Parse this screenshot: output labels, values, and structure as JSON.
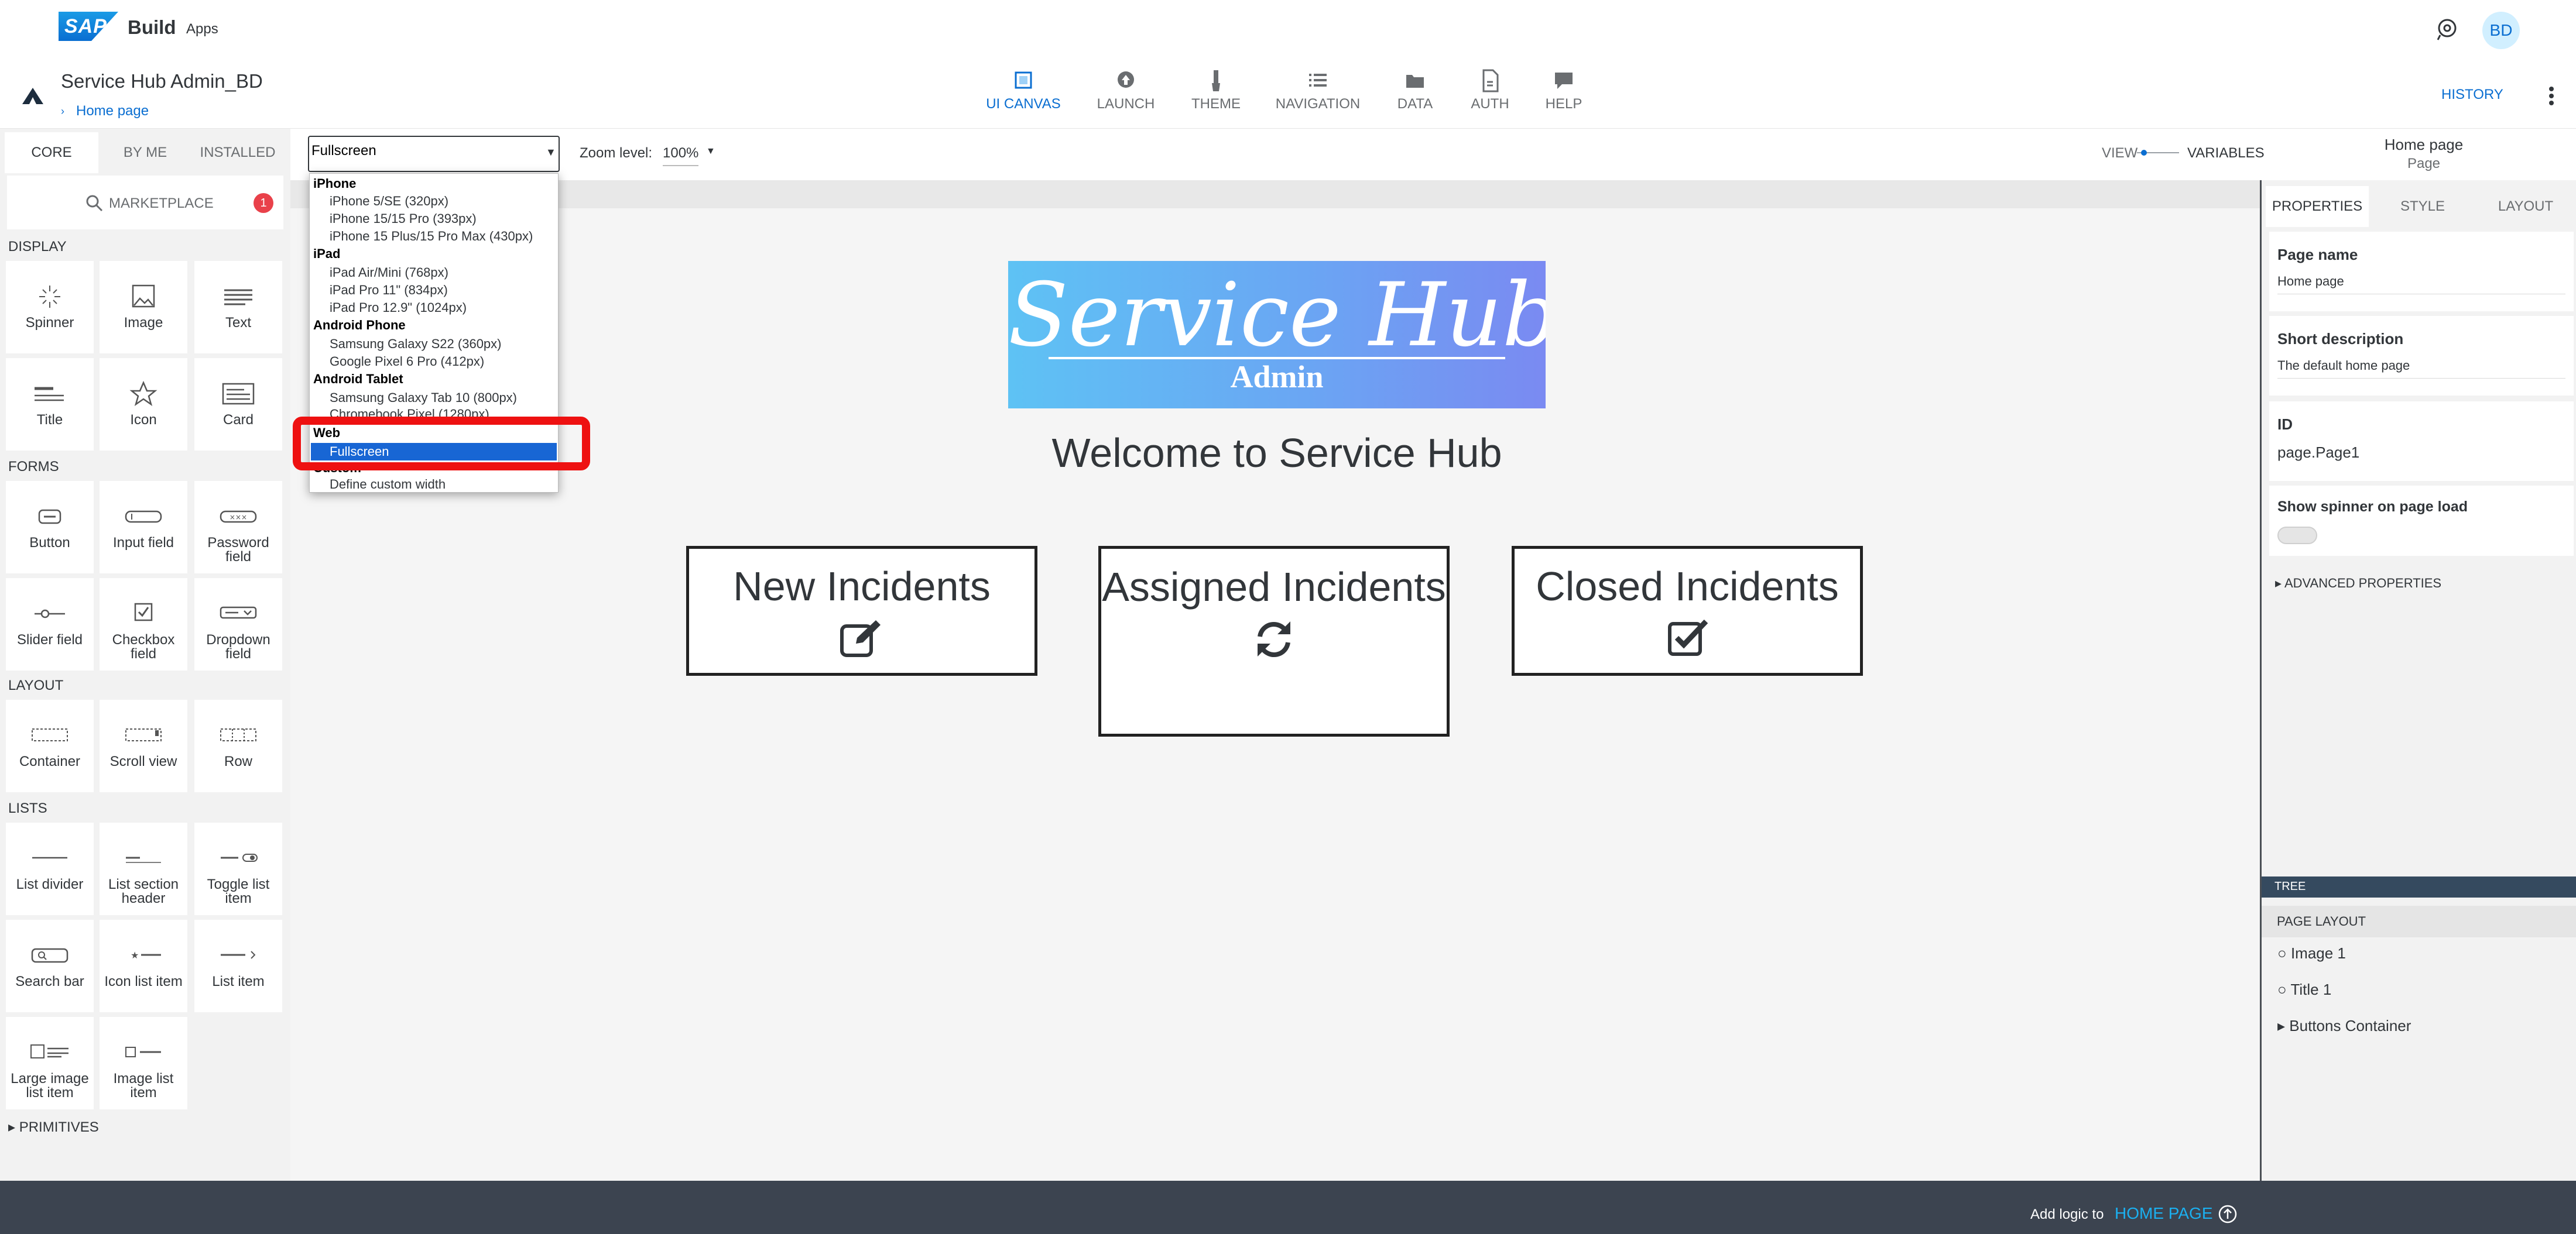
{
  "shell": {
    "logo_text": "SAP",
    "product": "Build",
    "product_sub": "Apps",
    "avatar_initials": "BD"
  },
  "app_header": {
    "project_name": "Service Hub Admin_BD",
    "breadcrumb": "Home page",
    "tabs": [
      {
        "label": "UI CANVAS",
        "icon": "canvas-icon",
        "active": true
      },
      {
        "label": "LAUNCH",
        "icon": "upload-icon",
        "active": false
      },
      {
        "label": "THEME",
        "icon": "brush-icon",
        "active": false
      },
      {
        "label": "NAVIGATION",
        "icon": "list-icon",
        "active": false
      },
      {
        "label": "DATA",
        "icon": "folder-icon",
        "active": false
      },
      {
        "label": "AUTH",
        "icon": "document-icon",
        "active": false
      },
      {
        "label": "HELP",
        "icon": "chat-icon",
        "active": false
      }
    ],
    "history_label": "HISTORY"
  },
  "palette": {
    "tabs": [
      "CORE",
      "BY ME",
      "INSTALLED"
    ],
    "active_tab": "CORE",
    "marketplace_label": "MARKETPLACE",
    "marketplace_badge": "1",
    "sections": [
      {
        "title": "DISPLAY",
        "items": [
          "Spinner",
          "Image",
          "Text",
          "Title",
          "Icon",
          "Card"
        ]
      },
      {
        "title": "FORMS",
        "items": [
          "Button",
          "Input field",
          "Password field",
          "Slider field",
          "Checkbox field",
          "Dropdown field"
        ]
      },
      {
        "title": "LAYOUT",
        "items": [
          "Container",
          "Scroll view",
          "Row"
        ]
      },
      {
        "title": "LISTS",
        "items": [
          "List divider",
          "List section header",
          "Toggle list item",
          "Search bar",
          "Icon list item",
          "List item",
          "Large image list item",
          "Image list item"
        ]
      }
    ],
    "primitives_label": "PRIMITIVES"
  },
  "toolbar": {
    "device_value": "Fullscreen",
    "zoom_label": "Zoom level:",
    "zoom_value": "100%",
    "view_label": "VIEW",
    "variables_label": "VARIABLES",
    "selected_name": "Home page",
    "selected_type": "Page"
  },
  "dropdown": {
    "groups": [
      {
        "name": "iPhone",
        "options": [
          "iPhone 5/SE (320px)",
          "iPhone 15/15 Pro (393px)",
          "iPhone 15 Plus/15 Pro Max (430px)"
        ]
      },
      {
        "name": "iPad",
        "options": [
          "iPad Air/Mini (768px)",
          "iPad Pro 11\" (834px)",
          "iPad Pro 12.9\" (1024px)"
        ]
      },
      {
        "name": "Android Phone",
        "options": [
          "Samsung Galaxy S22 (360px)",
          "Google Pixel 6 Pro (412px)"
        ]
      },
      {
        "name": "Android Tablet",
        "options": [
          "Samsung Galaxy Tab 10 (800px)",
          "Chromebook Pixel (1280px)"
        ]
      },
      {
        "name": "Web",
        "options": [
          "Fullscreen"
        ]
      },
      {
        "name": "Custom",
        "options": [
          "Define custom width"
        ]
      }
    ],
    "selected": "Fullscreen"
  },
  "canvas": {
    "hero_title": "Service Hub",
    "hero_subtitle": "Admin",
    "welcome": "Welcome to Service Hub",
    "buttons": [
      {
        "label": "New Incidents",
        "icon": "edit-icon"
      },
      {
        "label": "Assigned Incidents",
        "icon": "refresh-icon"
      },
      {
        "label": "Closed Incidents",
        "icon": "checkbox-icon"
      }
    ]
  },
  "properties": {
    "tabs": [
      "PROPERTIES",
      "STYLE",
      "LAYOUT"
    ],
    "active_tab": "PROPERTIES",
    "page_name_label": "Page name",
    "page_name_value": "Home page",
    "short_desc_label": "Short description",
    "short_desc_value": "The default home page",
    "id_label": "ID",
    "id_value": "page.Page1",
    "spinner_label": "Show spinner on page load",
    "spinner_enabled": false,
    "advanced_label": "ADVANCED PROPERTIES",
    "tree_label": "TREE",
    "page_layout_label": "PAGE LAYOUT",
    "tree_items": [
      "Image 1",
      "Title 1",
      "Buttons Container"
    ]
  },
  "bottom_bar": {
    "logic_label": "Add logic to",
    "logic_target": "HOME PAGE"
  },
  "colors": {
    "accent": "#0a6ed1",
    "highlight": "#ee1111",
    "selection": "#1866d4",
    "bottom_bar": "#3c4450"
  }
}
